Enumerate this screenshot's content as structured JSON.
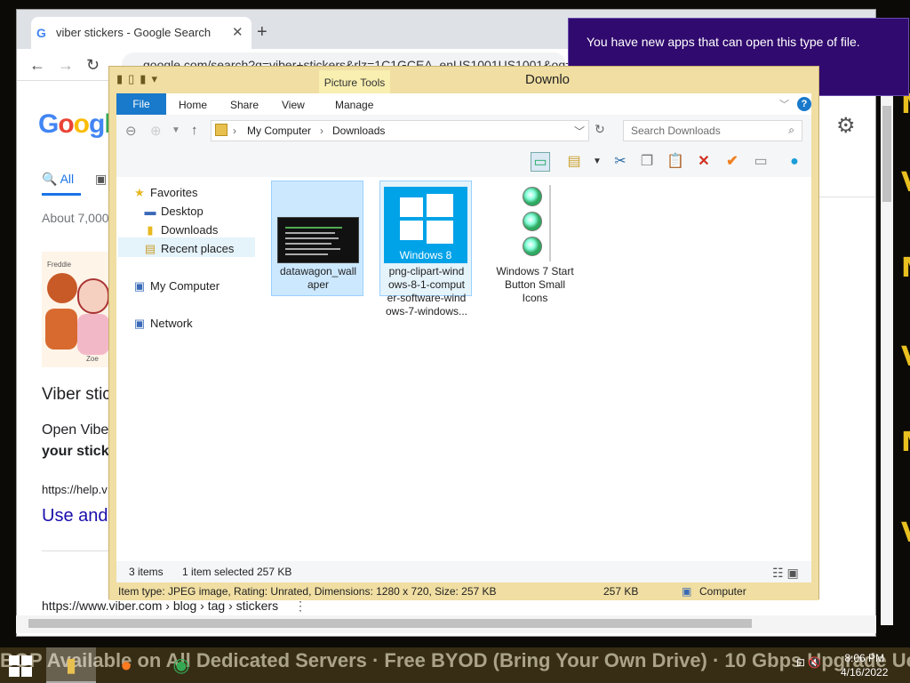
{
  "chrome": {
    "tab_title": "viber stickers - Google Search",
    "url": "google.com/search?q=viber+stickers&rlz=1C1GCEA_enUS1001US1001&oq=v",
    "window_controls": "▭  ✕",
    "google_logo": "Google",
    "all_tab": "All",
    "about_results": "About 7,000",
    "result_title": "Viber stic",
    "result_open": "Open Vibe",
    "result_bold": "your sticke",
    "result_https": "https://help.v",
    "use_link": "Use and",
    "bottom_url": "https://www.viber.com › blog › tag › stickers",
    "thumb_name1": "Freddie",
    "thumb_name2": "Zoe"
  },
  "notification": {
    "text": "You have new apps that can open this type of file."
  },
  "explorer": {
    "title": "Downlo",
    "contextual_tab": "Picture Tools",
    "ribbon_tabs": [
      "File",
      "Home",
      "Share",
      "View",
      "Manage"
    ],
    "breadcrumb": [
      "My Computer",
      "Downloads"
    ],
    "search_placeholder": "Search Downloads",
    "nav": {
      "favorites": "Favorites",
      "desktop": "Desktop",
      "downloads": "Downloads",
      "recent": "Recent places",
      "computer": "My Computer",
      "network": "Network"
    },
    "files": [
      {
        "name": "datawagon_wallpaper",
        "label": "datawagon_wall\naper"
      },
      {
        "name": "png-clipart-windows-8-1-computer-software-windows-7-windows",
        "label": "png-clipart-wind\nows-8-1-comput\ner-software-wind\nows-7-windows..."
      },
      {
        "name": "Windows 7 Start Button Small Icons",
        "label": "Windows 7 Start\nButton Small\nIcons"
      }
    ],
    "thumb2_caption": "Windows 8",
    "status_items": "3 items",
    "status_selected": "1 item selected",
    "status_size": "257 KB",
    "details_text": "Item type: JPEG image, Rating: Unrated, Dimensions: 1280 x 720, Size: 257 KB",
    "details_size": "257 KB",
    "details_location": "Computer"
  },
  "taskbar": {
    "marquee": "BGP Available on All Dedicated Servers · Free BYOD (Bring Your Own Drive) · 10 Gbps Upgrade Ue",
    "time": "8:06 PM",
    "date": "4/16/2022"
  },
  "colors": {
    "explorer_frame": "#f0dea2",
    "ribbon_file": "#1979ca",
    "notification_bg": "#300a6e",
    "selection": "#cce8ff",
    "taskbar": "#372c14"
  },
  "icons": [
    "google-icon",
    "close-icon",
    "plus-icon",
    "back-icon",
    "forward-icon",
    "reload-icon",
    "gear-icon",
    "folder-icon",
    "star-icon",
    "desktop-icon",
    "computer-icon",
    "network-icon",
    "search-icon",
    "refresh-icon",
    "help-icon",
    "windows-start-icon",
    "firefox-icon",
    "chrome-icon",
    "file-explorer-icon"
  ]
}
